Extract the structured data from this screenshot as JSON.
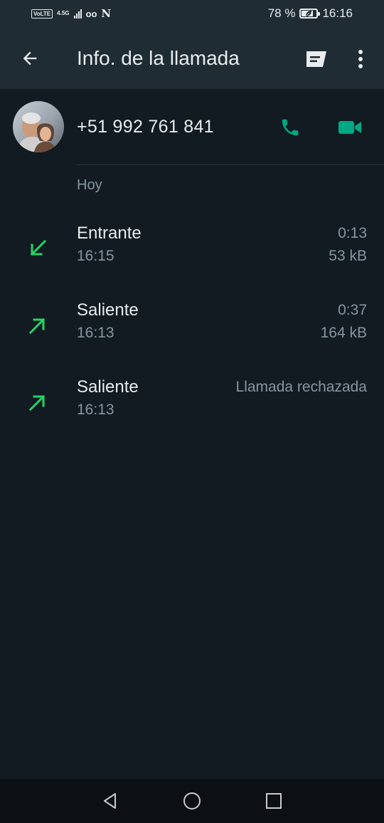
{
  "status_bar": {
    "volte": "VoLTE",
    "network": "4.5G",
    "battery": "78 %",
    "battery_level": 0.78,
    "time": "16:16",
    "icons": [
      "volte-icon",
      "signal-icon",
      "voicemail-icon",
      "n-icon",
      "battery-icon"
    ]
  },
  "app_bar": {
    "title": "Info. de la llamada",
    "icons": [
      "back-arrow-icon",
      "message-icon",
      "more-vert-icon"
    ]
  },
  "contact": {
    "phone_number": "+51 992 761 841",
    "icons": [
      "avatar",
      "phone-icon",
      "video-icon"
    ]
  },
  "accent_color": "#00a884",
  "arrow_color": "#25d366",
  "section": {
    "label": "Hoy"
  },
  "calls": [
    {
      "type": "Entrante",
      "time": "16:15",
      "duration": "0:13",
      "size": "53 kB",
      "direction": "incoming",
      "icon": "incoming-arrow-icon"
    },
    {
      "type": "Saliente",
      "time": "16:13",
      "duration": "0:37",
      "size": "164 kB",
      "direction": "outgoing",
      "icon": "outgoing-arrow-icon"
    },
    {
      "type": "Saliente",
      "time": "16:13",
      "status": "Llamada rechazada",
      "direction": "outgoing",
      "icon": "outgoing-arrow-icon"
    }
  ],
  "nav_bar": {
    "icons": [
      "nav-back-icon",
      "nav-home-icon",
      "nav-recents-icon"
    ]
  }
}
